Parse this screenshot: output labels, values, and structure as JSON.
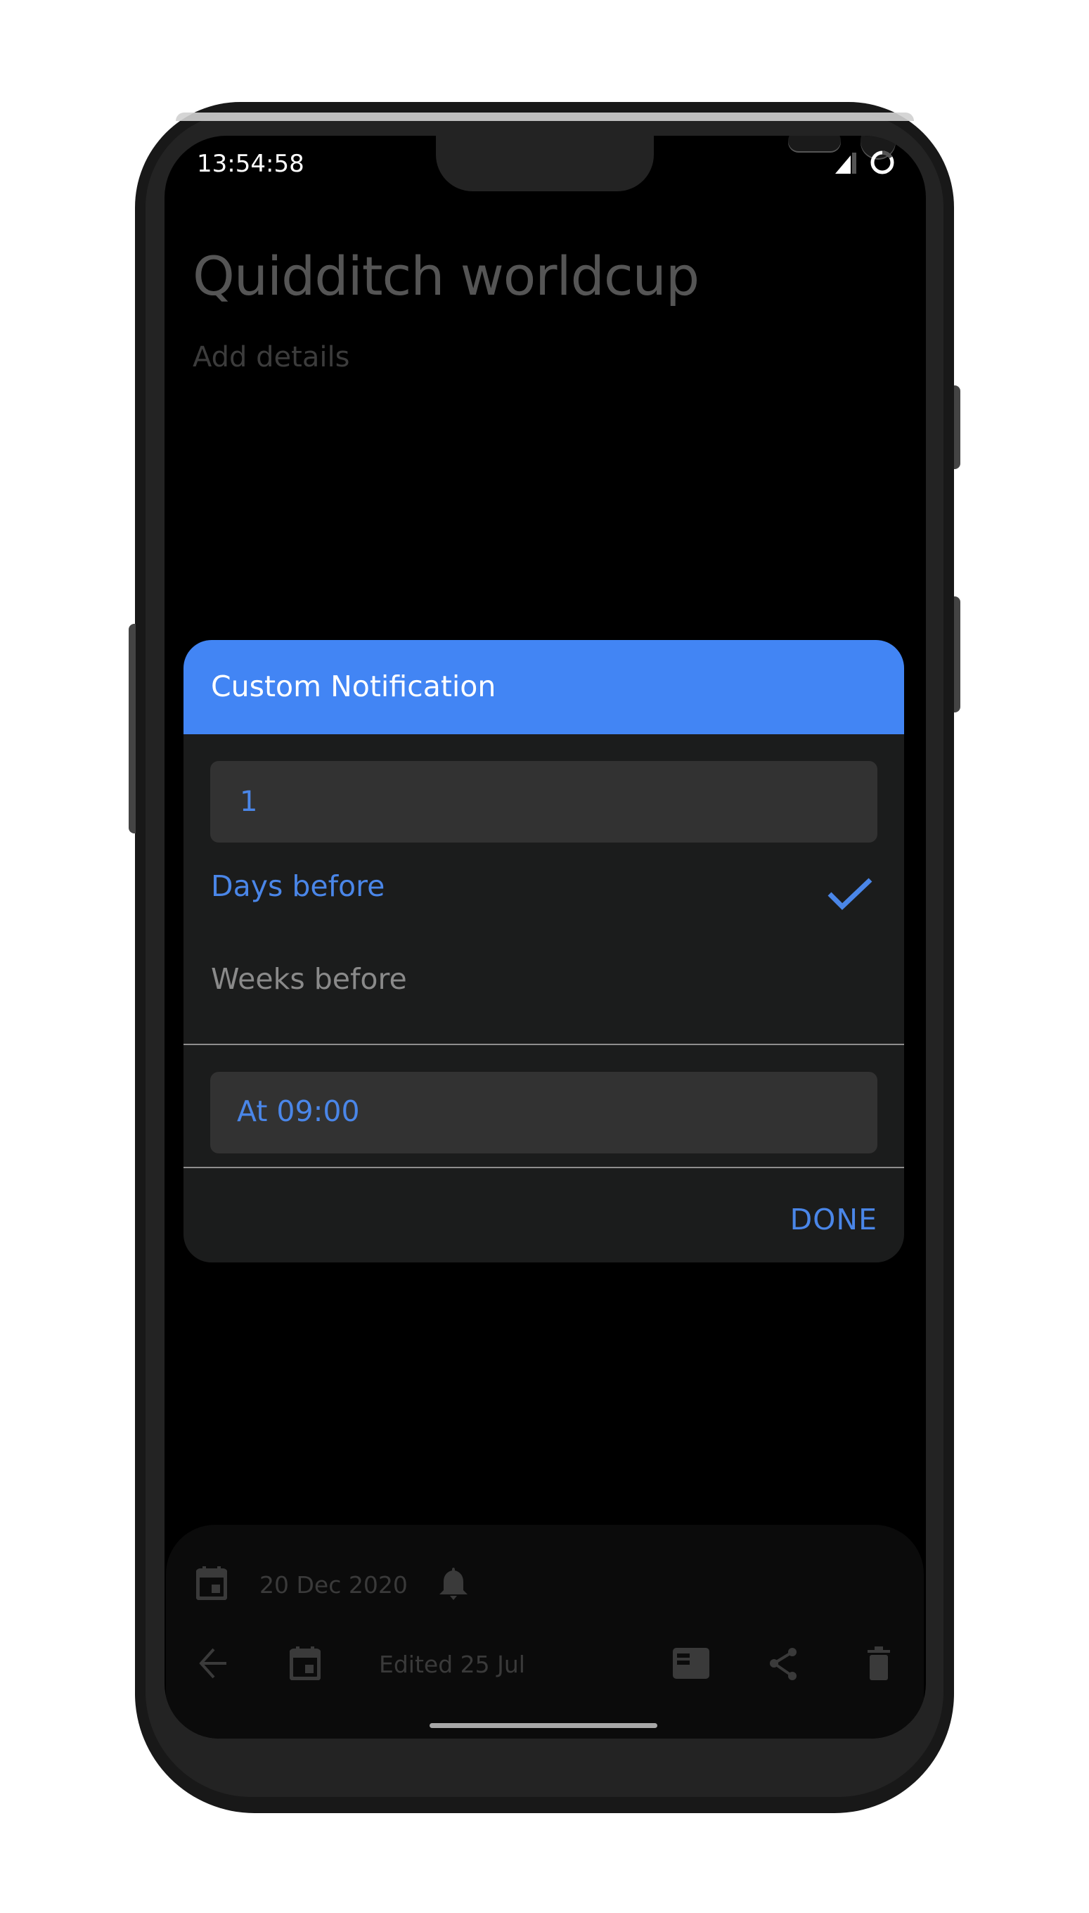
{
  "status_bar": {
    "time": "13:54:58",
    "icons": [
      "signal-icon",
      "battery-icon"
    ]
  },
  "note": {
    "title": "Quidditch worldcup",
    "details_placeholder": "Add details"
  },
  "dialog": {
    "title": "Custom Notification",
    "amount_value": "1",
    "options": [
      {
        "label": "Days before",
        "selected": true
      },
      {
        "label": "Weeks before",
        "selected": false
      }
    ],
    "time_label": "At 09:00",
    "done_label": "DONE"
  },
  "bottom_bar": {
    "reminder_date": "20 Dec 2020",
    "edited_text": "Edited 25 Jul",
    "icons": [
      "calendar-icon",
      "bell-icon",
      "back-arrow-icon",
      "calendar-icon",
      "notes-icon",
      "share-icon",
      "trash-icon"
    ]
  },
  "colors": {
    "accent": "#4285f4",
    "accent_text": "#4a86e8",
    "dialog_bg": "#1b1c1c",
    "field_bg": "#323232",
    "screen_bg": "#000000"
  }
}
